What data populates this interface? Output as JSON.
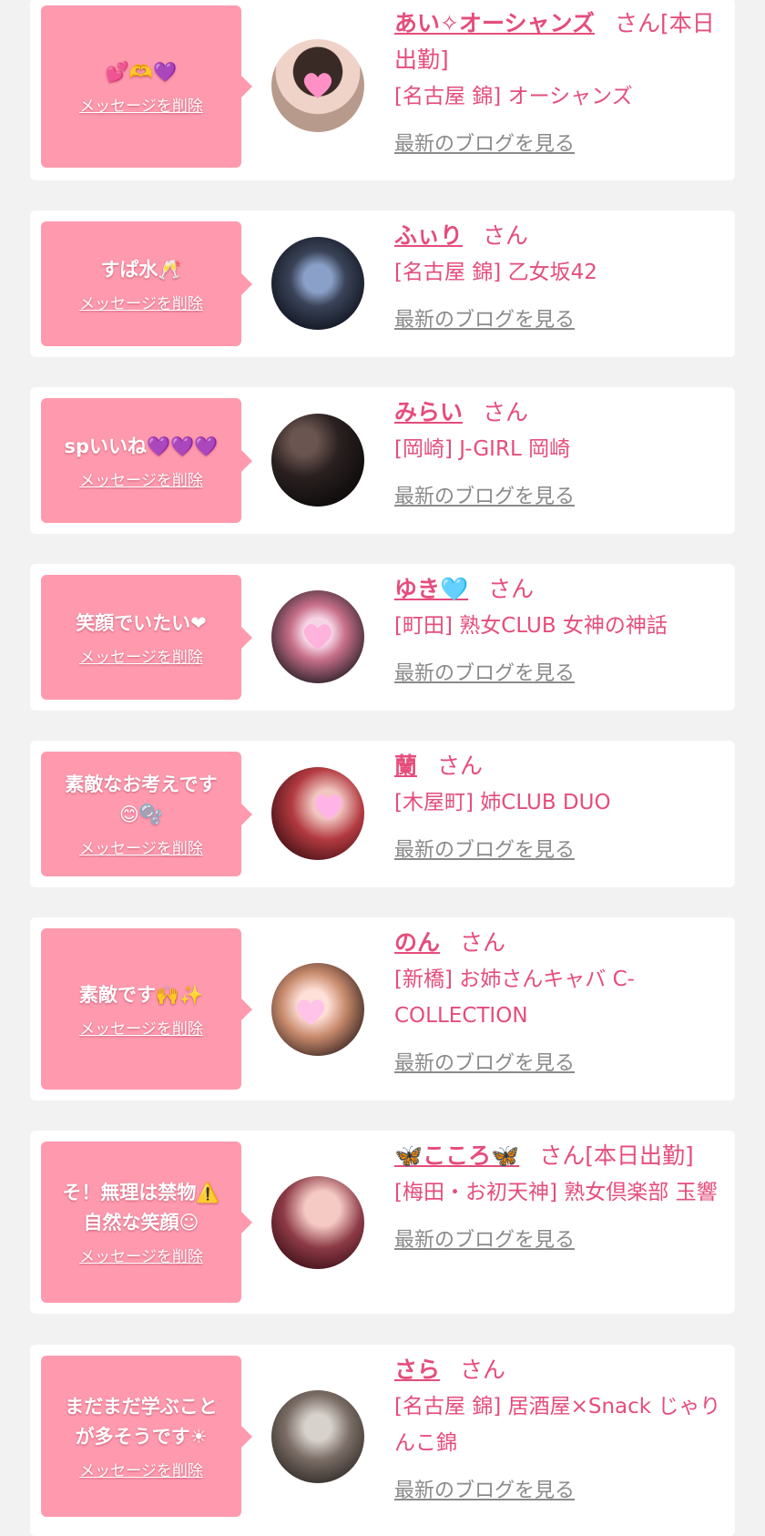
{
  "delete_label": "メッセージを削除",
  "honorific": "さん",
  "blog_label": "最新のブログを見る",
  "colors": {
    "accent": "#e54d7b",
    "message_bg": "#ff9aae",
    "page_bg": "#f2f2f2"
  },
  "entries": [
    {
      "message": "💕🫶💜",
      "name": "あい✧オーシャンズ",
      "status": "[本日出勤]",
      "shop": "[名古屋 錦] オーシャンズ"
    },
    {
      "message": "すぱ水🥂",
      "name": "ふぃり",
      "status": "",
      "shop": "[名古屋 錦] 乙女坂42"
    },
    {
      "message": "spいいね💜💜💜",
      "name": "みらい",
      "status": "",
      "shop": "[岡崎] J-GIRL 岡崎"
    },
    {
      "message": "笑顔でいたい❤",
      "name": "ゆき🩵",
      "status": "",
      "shop": "[町田] 熟女CLUB 女神の神話"
    },
    {
      "message": "素敵なお考えです\n😊🫧",
      "name": "蘭",
      "status": "",
      "shop": "[木屋町] 姉CLUB DUO"
    },
    {
      "message": "素敵です🙌✨",
      "name": "のん",
      "status": "",
      "shop": "[新橋] お姉さんキャバ C-COLLECTION"
    },
    {
      "message": "そ！無理は禁物⚠️\n自然な笑顔☺",
      "name": "🦋こころ🦋",
      "status": "[本日出勤]",
      "shop": "[梅田・お初天神] 熟女倶楽部 玉響"
    },
    {
      "message": "まだまだ学ぶこと\nが多そうです☀",
      "name": "さら",
      "status": "",
      "shop": "[名古屋 錦] 居酒屋×Snack じゃりんこ錦"
    }
  ]
}
